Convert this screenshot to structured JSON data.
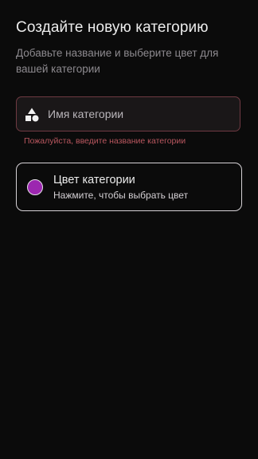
{
  "header": {
    "title": "Создайте новую категорию",
    "subtitle": "Добавьте название и выберите цвет для вашей категории"
  },
  "name_field": {
    "placeholder": "Имя категории",
    "value": "",
    "icon": "shapes-icon",
    "error": "Пожалуйста, введите название категории"
  },
  "color_picker": {
    "title": "Цвет категории",
    "hint": "Нажмите, чтобы выбрать цвет",
    "selected_color": "#9c27b0"
  },
  "theme": {
    "background": "#0b0b0b",
    "error": "#b9575f",
    "field_border_error": "#6f3a42",
    "card_border": "#d6d2d6"
  }
}
